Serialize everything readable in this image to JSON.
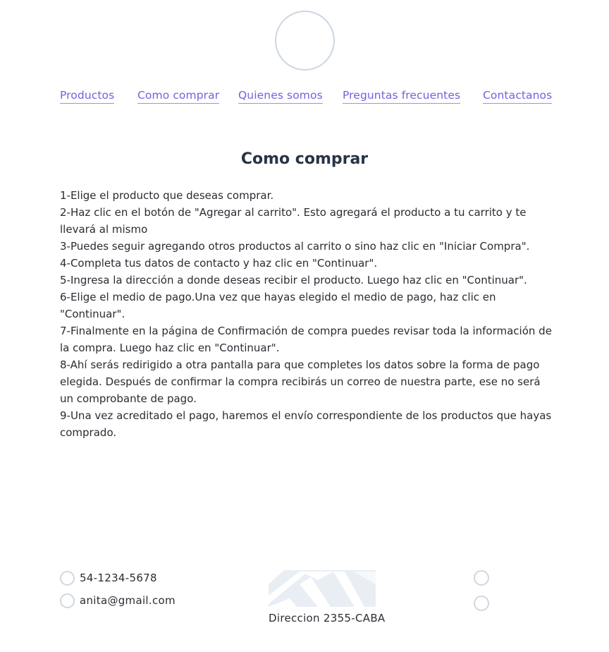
{
  "nav": {
    "items": [
      {
        "label": "Productos"
      },
      {
        "label": "Como comprar"
      },
      {
        "label": "Quienes somos"
      },
      {
        "label": "Preguntas frecuentes"
      },
      {
        "label": "Contactanos"
      }
    ]
  },
  "page": {
    "title": "Como comprar"
  },
  "steps": [
    "1-Elige el producto que deseas comprar.",
    "2-Haz clic en el botón de \"Agregar al carrito\". Esto agregará el producto a tu carrito y te llevará al mismo",
    "3-Puedes seguir agregando otros productos al carrito o sino haz clic en \"Iniciar Compra\".",
    "4-Completa tus datos de contacto y haz clic en \"Continuar\".",
    "5-Ingresa la dirección a donde deseas recibir el producto. Luego haz clic en \"Continuar\".",
    "6-Elige el medio de pago.Una vez que hayas elegido el medio de pago, haz clic en \"Continuar\".",
    "7-Finalmente en la página de Confirmación de compra puedes revisar toda la información de la compra. Luego haz clic en \"Continuar\".",
    "8-Ahí serás redirigido a otra pantalla para que completes los datos sobre la forma de pago elegida. Después de confirmar la compra recibirás un correo de nuestra parte, ese no será un comprobante de pago.",
    "9-Una vez acreditado el pago, haremos el envío correspondiente de los productos que hayas comprado."
  ],
  "footer": {
    "phone": "54-1234-5678",
    "email": "anita@gmail.com",
    "address": "Direccion 2355-CABA"
  },
  "colors": {
    "link": "#6f63e0",
    "title": "#263544",
    "icon_border": "#cfd7e0",
    "map": "#e8edf3"
  },
  "icons": {
    "logo": "logo-placeholder-circle",
    "phone": "phone-icon",
    "email": "email-icon",
    "map": "map-image",
    "social1": "social-icon-1",
    "social2": "social-icon-2"
  }
}
